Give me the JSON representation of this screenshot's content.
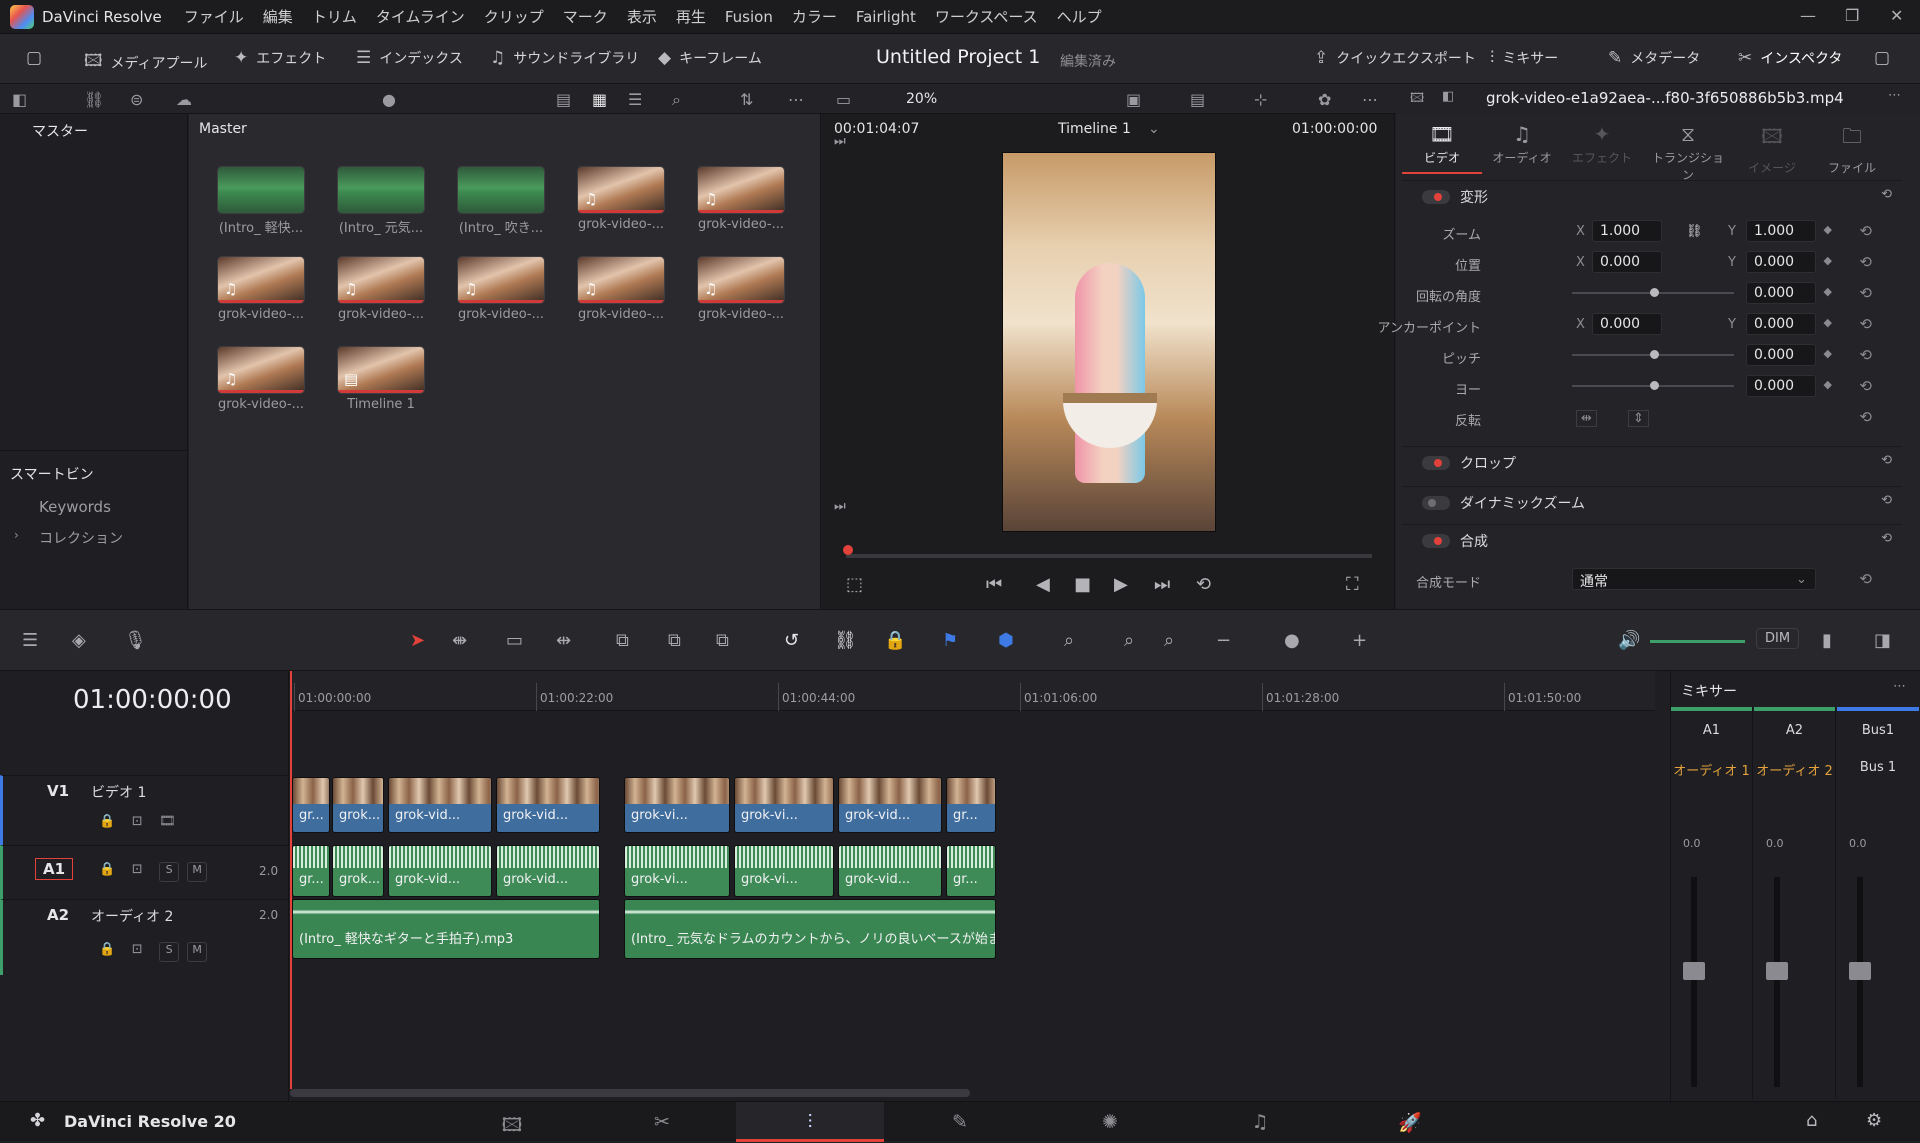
{
  "app": {
    "name": "DaVinci Resolve",
    "footer_name": "DaVinci Resolve 20"
  },
  "menu": [
    "ファイル",
    "編集",
    "トリム",
    "タイムライン",
    "クリップ",
    "マーク",
    "表示",
    "再生",
    "Fusion",
    "カラー",
    "Fairlight",
    "ワークスペース",
    "ヘルプ"
  ],
  "toolbar": {
    "media_pool": "メディアプール",
    "effects": "エフェクト",
    "index": "インデックス",
    "sound_library": "サウンドライブラリ",
    "keyframes": "キーフレーム",
    "project_title": "Untitled Project 1",
    "project_state": "編集済み",
    "quick_export": "クイックエクスポート",
    "mixer": "ミキサー",
    "metadata": "メタデータ",
    "inspector": "インスペクタ"
  },
  "zoom": "20%",
  "sidebar": {
    "master": "マスター",
    "smart_bins": "スマートビン",
    "keywords": "Keywords",
    "collections": "コレクション"
  },
  "pool": {
    "title": "Master",
    "clips": [
      {
        "label": "(Intro_ 軽快...",
        "kind": "audio"
      },
      {
        "label": "(Intro_ 元気...",
        "kind": "audio"
      },
      {
        "label": "(Intro_ 吹き...",
        "kind": "audio"
      },
      {
        "label": "grok-video-...",
        "kind": "video"
      },
      {
        "label": "grok-video-...",
        "kind": "video"
      },
      {
        "label": "grok-video-...",
        "kind": "video"
      },
      {
        "label": "grok-video-...",
        "kind": "video"
      },
      {
        "label": "grok-video-...",
        "kind": "video"
      },
      {
        "label": "grok-video-...",
        "kind": "video"
      },
      {
        "label": "grok-video-...",
        "kind": "video"
      },
      {
        "label": "grok-video-...",
        "kind": "video"
      },
      {
        "label": "Timeline 1",
        "kind": "timeline"
      }
    ]
  },
  "viewer": {
    "duration": "00:01:04:07",
    "timeline": "Timeline 1",
    "timecode": "01:00:00:00"
  },
  "inspector": {
    "file": "grok-video-e1a92aea-...f80-3f650886b5b3.mp4",
    "tabs": [
      "ビデオ",
      "オーディオ",
      "エフェクト",
      "トランジション",
      "イメージ",
      "ファイル"
    ],
    "transform": "変形",
    "zoom_label": "ズーム",
    "zoom_x": "1.000",
    "zoom_y": "1.000",
    "pos_label": "位置",
    "pos_x": "0.000",
    "pos_y": "0.000",
    "rot_label": "回転の角度",
    "rot": "0.000",
    "anchor_label": "アンカーポイント",
    "anchor_x": "0.000",
    "anchor_y": "0.000",
    "pitch_label": "ピッチ",
    "pitch": "0.000",
    "yaw_label": "ヨー",
    "yaw": "0.000",
    "flip_label": "反転",
    "crop": "クロップ",
    "dynamic_zoom": "ダイナミックズーム",
    "composite": "合成",
    "blend_label": "合成モード",
    "blend_value": "通常",
    "axis_x": "X",
    "axis_y": "Y"
  },
  "timeline": {
    "timecode": "01:00:00:00",
    "ruler": [
      "01:00:00:00",
      "01:00:22:00",
      "01:00:44:00",
      "01:01:06:00",
      "01:01:28:00",
      "01:01:50:00"
    ],
    "v1": {
      "id": "V1",
      "name": "ビデオ 1"
    },
    "a1": {
      "id": "A1",
      "level": "2.0"
    },
    "a2": {
      "id": "A2",
      "name": "オーディオ 2",
      "level": "2.0"
    },
    "s": "S",
    "m": "M",
    "clip_labels": [
      "gr...",
      "grok...",
      "grok-vid...",
      "grok-vid...",
      "grok-vi...",
      "grok-vi...",
      "grok-vid...",
      "gr..."
    ],
    "music1": "(Intro_ 軽快なギターと手拍子).mp3",
    "music2": "(Intro_ 元気なドラムのカウントから、ノリの良いベースが始まる).m..."
  },
  "mixer": {
    "title": "ミキサー",
    "channels": [
      {
        "name": "A1",
        "route": "オーディオ 1",
        "level": "0.0"
      },
      {
        "name": "A2",
        "route": "オーディオ 2",
        "level": "0.0"
      },
      {
        "name": "Bus1",
        "route": "Bus 1",
        "level": "0.0"
      }
    ]
  },
  "dim": "DIM",
  "colors": {
    "accent": "#e3423b",
    "video_clip": "#3e6d9e",
    "audio_clip": "#3f8b58"
  }
}
